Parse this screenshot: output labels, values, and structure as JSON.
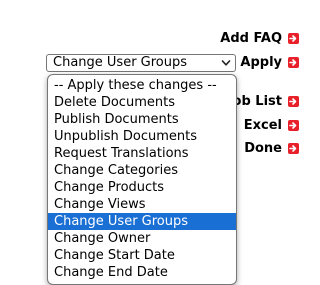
{
  "actions": {
    "add_faq": "Add FAQ",
    "apply": "Apply",
    "job_list": "Job List",
    "excel": "Excel",
    "done": "Done"
  },
  "bulk_select": {
    "selected_value": "Change User Groups",
    "options": [
      "-- Apply these changes --",
      "Delete Documents",
      "Publish Documents",
      "Unpublish Documents",
      "Request Translations",
      "Change Categories",
      "Change Products",
      "Change Views",
      "Change User Groups",
      "Change Owner",
      "Change Start Date",
      "Change End Date"
    ],
    "highlighted_index": 8
  },
  "icons": {
    "action_icon": "red-arrow-go-icon",
    "select_chevron": "chevron-down-icon"
  },
  "colors": {
    "action_icon_bg": "#e8202a",
    "highlight_bg": "#1a6fd4",
    "highlight_text": "#ffffff"
  }
}
